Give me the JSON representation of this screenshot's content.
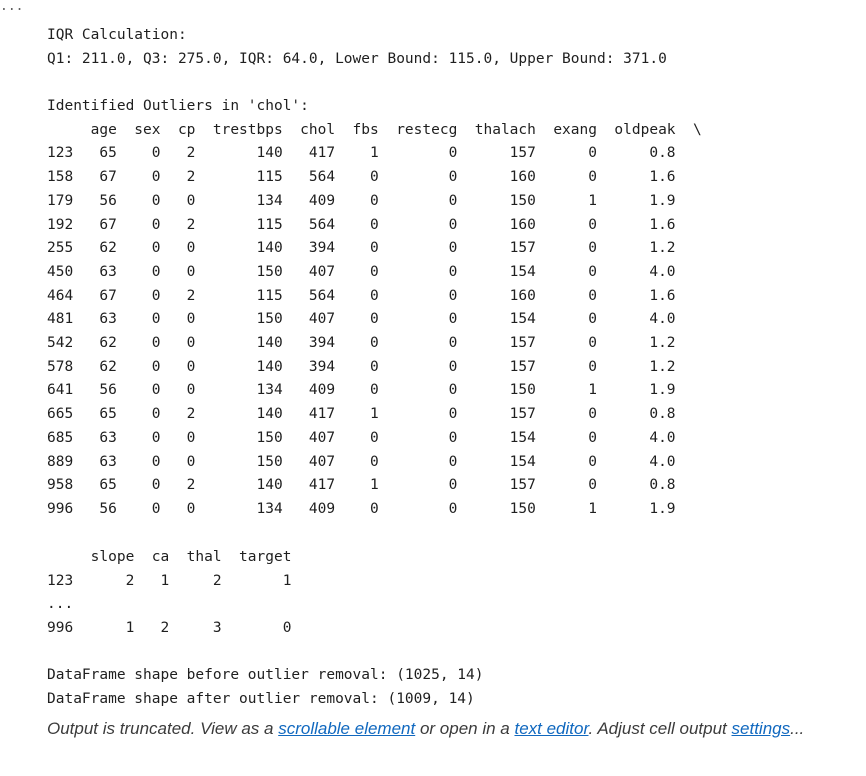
{
  "top_ellipsis": "...",
  "iqr": {
    "heading": "IQR Calculation:",
    "summary": "Q1: 211.0, Q3: 275.0, IQR: 64.0, Lower Bound: 115.0, Upper Bound: 371.0"
  },
  "outliers": {
    "heading": "Identified Outliers in 'chol':",
    "header_row": "     age  sex  cp  trestbps  chol  fbs  restecg  thalach  exang  oldpeak  \\",
    "rows": [
      "123   65    0   2       140   417    1        0      157      0      0.8",
      "158   67    0   2       115   564    0        0      160      0      1.6",
      "179   56    0   0       134   409    0        0      150      1      1.9",
      "192   67    0   2       115   564    0        0      160      0      1.6",
      "255   62    0   0       140   394    0        0      157      0      1.2",
      "450   63    0   0       150   407    0        0      154      0      4.0",
      "464   67    0   2       115   564    0        0      160      0      1.6",
      "481   63    0   0       150   407    0        0      154      0      4.0",
      "542   62    0   0       140   394    0        0      157      0      1.2",
      "578   62    0   0       140   394    0        0      157      0      1.2",
      "641   56    0   0       134   409    0        0      150      1      1.9",
      "665   65    0   2       140   417    1        0      157      0      0.8",
      "685   63    0   0       150   407    0        0      154      0      4.0",
      "889   63    0   0       150   407    0        0      154      0      4.0",
      "958   65    0   2       140   417    1        0      157      0      0.8",
      "996   56    0   0       134   409    0        0      150      1      1.9"
    ]
  },
  "second_table": {
    "header_row": "     slope  ca  thal  target",
    "row_first": "123      2   1     2       1",
    "row_ellipsis": "...",
    "row_last": "996      1   2     3       0"
  },
  "shapes": {
    "before": "DataFrame shape before outlier removal: (1025, 14)",
    "after": "DataFrame shape after outlier removal: (1009, 14)"
  },
  "truncation_notice": {
    "prefix": "Output is truncated. View as a ",
    "link_scrollable": "scrollable element",
    "middle": " or open in a ",
    "link_editor": "text editor",
    "middle2": ". Adjust cell output ",
    "link_settings": "settings",
    "suffix": "..."
  }
}
